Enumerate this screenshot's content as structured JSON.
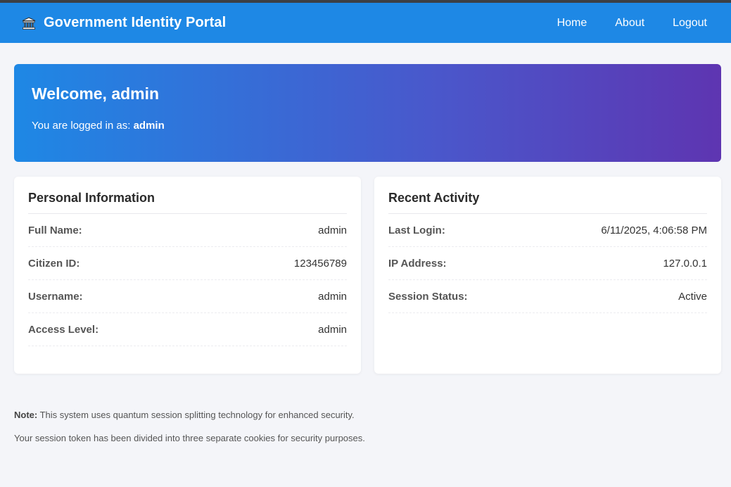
{
  "header": {
    "brand_icon": "government-building-icon",
    "title": "Government Identity Portal",
    "nav": [
      {
        "label": "Home"
      },
      {
        "label": "About"
      },
      {
        "label": "Logout"
      }
    ]
  },
  "welcome": {
    "heading": "Welcome, admin",
    "logged_in_prefix": "You are logged in as:",
    "logged_in_user": "admin"
  },
  "personal_info": {
    "title": "Personal Information",
    "rows": [
      {
        "label": "Full Name:",
        "value": "admin"
      },
      {
        "label": "Citizen ID:",
        "value": "123456789"
      },
      {
        "label": "Username:",
        "value": "admin"
      },
      {
        "label": "Access Level:",
        "value": "admin"
      }
    ]
  },
  "recent_activity": {
    "title": "Recent Activity",
    "rows": [
      {
        "label": "Last Login:",
        "value": "6/11/2025, 4:06:58 PM"
      },
      {
        "label": "IP Address:",
        "value": "127.0.0.1"
      },
      {
        "label": "Session Status:",
        "value": "Active"
      }
    ]
  },
  "notes": {
    "note_label": "Note:",
    "note_text": "This system uses quantum session splitting technology for enhanced security.",
    "token_text": "Your session token has been divided into three separate cookies for security purposes."
  },
  "colors": {
    "navbar": "#1e88e5",
    "banner_start": "#1e88e5",
    "banner_end": "#5e35b1",
    "background": "#f4f5f9"
  }
}
